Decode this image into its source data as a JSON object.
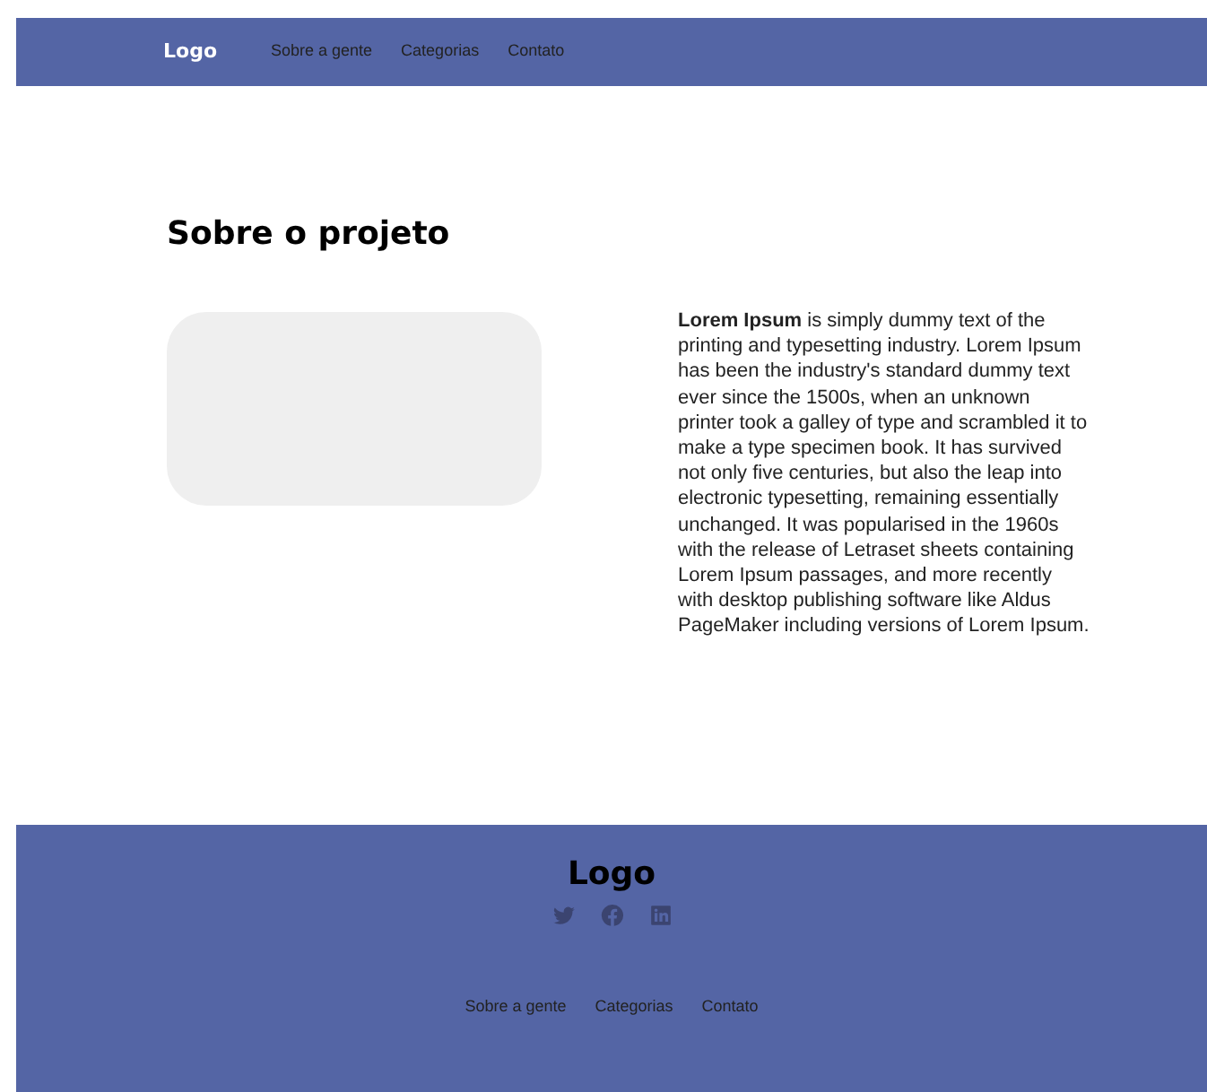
{
  "header": {
    "logo": "Logo",
    "nav": [
      "Sobre a gente",
      "Categorias",
      "Contato"
    ]
  },
  "main": {
    "title": "Sobre o projeto",
    "paragraph": "**Lorem Ipsum** is simply dummy text of the printing and typesetting industry. Lorem Ipsum has been the industry's standard dummy  text ever since the 1500s, when an unknown printer took a galley of  type and scrambled it to make a type specimen book. It has survived not  only five centuries, but also the leap into electronic typesetting,  remaining essentially unchanged. It was popularised in the 1960s with  the release of Letraset sheets containing Lorem Ipsum passages, and more  recently with desktop publishing software like Aldus PageMaker including versions of Lorem Ipsum."
  },
  "footer": {
    "logo": "Logo",
    "social": [
      {
        "kind": "twitter"
      },
      {
        "kind": "facebook"
      },
      {
        "kind": "linkedin"
      }
    ],
    "nav": [
      "Sobre a gente",
      "Categorias",
      "Contato"
    ]
  }
}
